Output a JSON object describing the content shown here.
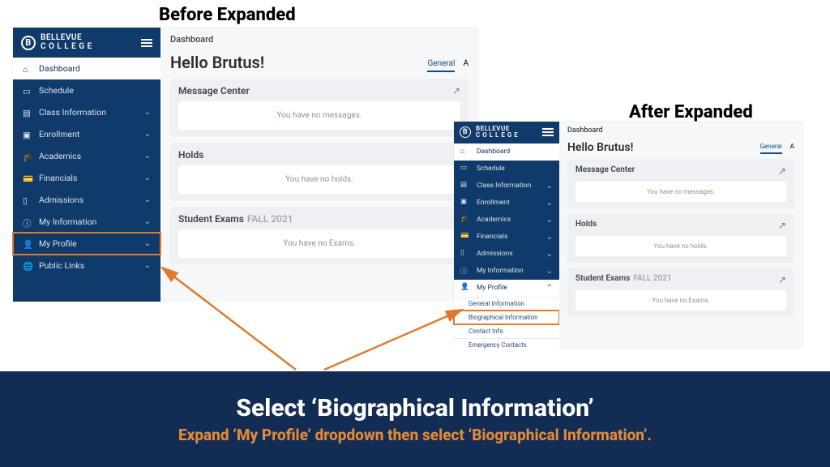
{
  "titles": {
    "before": "Before Expanded",
    "after": "After Expanded"
  },
  "brand": {
    "line1": "BELLEVUE",
    "line2": "C O L L E G E",
    "badge": "B"
  },
  "nav": {
    "dashboard": "Dashboard",
    "schedule": "Schedule",
    "classinfo": "Class Information",
    "enrollment": "Enrollment",
    "academics": "Academics",
    "financials": "Financials",
    "admissions": "Admissions",
    "myinfo": "My Information",
    "myprofile": "My Profile",
    "publiclinks": "Public Links"
  },
  "submenu": {
    "general": "General Information",
    "bio": "Biographical Information",
    "contact": "Contact Info",
    "emergency": "Emergency Contacts"
  },
  "main": {
    "page_title": "Dashboard",
    "hello": "Hello Brutus!",
    "tab_general": "General",
    "tab_a": "A",
    "msg_title": "Message Center",
    "msg_body": "You have no messages.",
    "holds_title": "Holds",
    "holds_body": "You have no holds.",
    "exams_title": "Student Exams",
    "exams_term": "FALL 2021",
    "exams_body": "You have no Exams.",
    "open_icon": "↗"
  },
  "banner": {
    "line1": "Select ‘Biographical Information’",
    "line2": "Expand ‘My Profile’ dropdown then select ‘Biographical Information’."
  }
}
